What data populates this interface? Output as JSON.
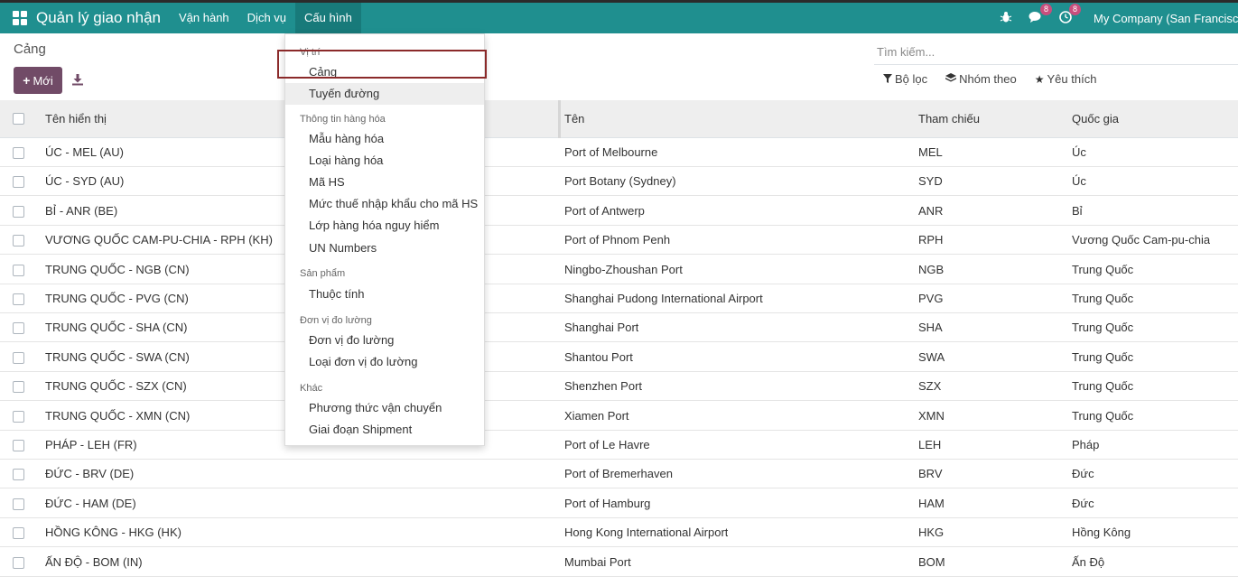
{
  "navbar": {
    "brand": "Quản lý giao nhận",
    "menus": [
      "Vận hành",
      "Dịch vụ",
      "Cấu hình"
    ],
    "bug_icon": "bug-icon",
    "chat_badge": "8",
    "activity_badge": "8",
    "company": "My Company (San Francisco"
  },
  "control": {
    "breadcrumb": "Cảng",
    "new_label": "Mới",
    "search_placeholder": "Tìm kiếm...",
    "filter_label": "Bộ lọc",
    "group_label": "Nhóm theo",
    "favorite_label": "Yêu thích"
  },
  "table": {
    "headers": [
      "Tên hiển thị",
      "Tên",
      "Tham chiếu",
      "Quốc gia"
    ],
    "rows": [
      [
        "ÚC - MEL (AU)",
        "Port of Melbourne",
        "MEL",
        "Úc"
      ],
      [
        "ÚC - SYD (AU)",
        "Port Botany (Sydney)",
        "SYD",
        "Úc"
      ],
      [
        "BỈ - ANR (BE)",
        "Port of Antwerp",
        "ANR",
        "Bỉ"
      ],
      [
        "VƯƠNG QUỐC CAM-PU-CHIA - RPH (KH)",
        "Port of Phnom Penh",
        "RPH",
        "Vương Quốc Cam-pu-chia"
      ],
      [
        "TRUNG QUỐC - NGB (CN)",
        "Ningbo-Zhoushan Port",
        "NGB",
        "Trung Quốc"
      ],
      [
        "TRUNG QUỐC - PVG (CN)",
        "Shanghai Pudong International Airport",
        "PVG",
        "Trung Quốc"
      ],
      [
        "TRUNG QUỐC - SHA (CN)",
        "Shanghai Port",
        "SHA",
        "Trung Quốc"
      ],
      [
        "TRUNG QUỐC - SWA (CN)",
        "Shantou Port",
        "SWA",
        "Trung Quốc"
      ],
      [
        "TRUNG QUỐC - SZX (CN)",
        "Shenzhen Port",
        "SZX",
        "Trung Quốc"
      ],
      [
        "TRUNG QUỐC - XMN (CN)",
        "Xiamen Port",
        "XMN",
        "Trung Quốc"
      ],
      [
        "PHÁP - LEH (FR)",
        "Port of Le Havre",
        "LEH",
        "Pháp"
      ],
      [
        "ĐỨC - BRV (DE)",
        "Port of Bremerhaven",
        "BRV",
        "Đức"
      ],
      [
        "ĐỨC - HAM (DE)",
        "Port of Hamburg",
        "HAM",
        "Đức"
      ],
      [
        "HỒNG KÔNG - HKG (HK)",
        "Hong Kong International Airport",
        "HKG",
        "Hồng Kông"
      ],
      [
        "ẤN ĐỘ - BOM (IN)",
        "Mumbai Port",
        "BOM",
        "Ấn Độ"
      ]
    ]
  },
  "dropdown": {
    "sections": [
      {
        "header": "Vị trí",
        "items": [
          "Cảng",
          "Tuyến đường"
        ]
      },
      {
        "header": "Thông tin hàng hóa",
        "items": [
          "Mẫu hàng hóa",
          "Loại hàng hóa",
          "Mã HS",
          "Mức thuế nhập khẩu cho mã HS",
          "Lớp hàng hóa nguy hiểm",
          "UN Numbers"
        ]
      },
      {
        "header": "Sản phẩm",
        "items": [
          "Thuộc tính"
        ]
      },
      {
        "header": "Đơn vị đo lường",
        "items": [
          "Đơn vị đo lường",
          "Loại đơn vị đo lường"
        ]
      },
      {
        "header": "Khác",
        "items": [
          "Phương thức vận chuyển",
          "Giai đoạn Shipment"
        ]
      }
    ]
  },
  "colors": {
    "navbar": "#1f8f8f",
    "primary_button": "#714b67",
    "highlight_box": "#8b2a2a"
  }
}
